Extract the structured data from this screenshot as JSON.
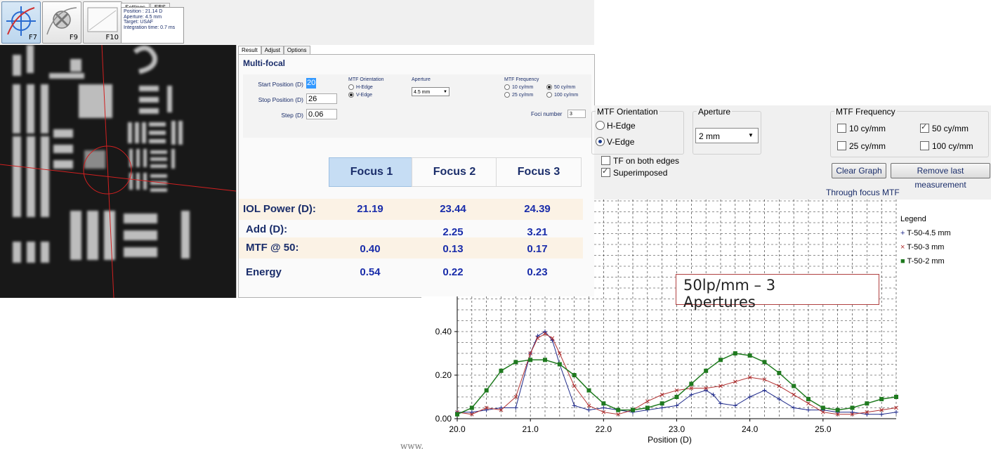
{
  "toolbar": {
    "buttons": [
      {
        "key": "F7",
        "icon": "crosshair-focus-icon",
        "active": true
      },
      {
        "key": "F9",
        "icon": "cancel-target-icon",
        "active": false
      },
      {
        "key": "F10",
        "icon": "blank-frame-icon",
        "active": false
      }
    ],
    "tabs": [
      "Settings",
      "EBS"
    ],
    "info": {
      "position": "Position : 21.14 D",
      "aperture": "Aperture: 4.5 mm",
      "target": "Target: USAF",
      "integration": "Integration time: 0.7 ms"
    }
  },
  "result_panel": {
    "tabs": [
      "Result",
      "Adjust",
      "Options"
    ],
    "title": "Multi-focal",
    "start_label": "Start Position (D)",
    "start_value": "20",
    "stop_label": "Stop Position (D)",
    "stop_value": "26",
    "step_label": "Step (D)",
    "step_value": "0.06",
    "mtf_orientation_label": "MTF Orientation",
    "h_edge": "H-Edge",
    "v_edge": "V-Edge",
    "aperture_label": "Aperture",
    "aperture_value": "4.5 mm",
    "mtf_freq_label": "MTF Frequency",
    "freq_10": "10 cy/mm",
    "freq_50": "50 cy/mm",
    "freq_25": "25 cy/mm",
    "freq_100": "100 cy/mm",
    "foci_label": "Foci number",
    "foci_value": "3",
    "focus_tabs": [
      "Focus 1",
      "Focus 2",
      "Focus 3"
    ],
    "rows": [
      {
        "label": "IOL Power (D):",
        "values": [
          "21.19",
          "23.44",
          "24.39"
        ]
      },
      {
        "label": "Add (D):",
        "values": [
          "",
          "2.25",
          "3.21"
        ]
      },
      {
        "label": "MTF @ 50:",
        "values": [
          "0.40",
          "0.13",
          "0.17"
        ]
      },
      {
        "label": "Energy",
        "values": [
          "0.54",
          "0.22",
          "0.23"
        ]
      }
    ]
  },
  "mtf_settings": {
    "orientation_label": "MTF Orientation",
    "h_edge": "H-Edge",
    "v_edge": "V-Edge",
    "v_edge_selected": true,
    "tf_both": "TF on both edges",
    "superimposed": "Superimposed",
    "aperture_label": "Aperture",
    "aperture_value": "2 mm",
    "freq_label": "MTF Frequency",
    "freq_10": "10 cy/mm",
    "freq_50": "50 cy/mm",
    "freq_25": "25 cy/mm",
    "freq_100": "100 cy/mm",
    "clear_graph": "Clear Graph",
    "remove_last": "Remove last measurement"
  },
  "chart_data": {
    "type": "line",
    "title": "Through focus MTF",
    "xlabel": "Position (D)",
    "ylabel": "",
    "xlim": [
      20.0,
      26.0
    ],
    "ylim": [
      0.0,
      0.6
    ],
    "xticks": [
      "20.0",
      "21.0",
      "22.0",
      "23.0",
      "24.0",
      "25.0"
    ],
    "yticks": [
      "0.00",
      "0.20",
      "0.40"
    ],
    "grid": true,
    "legend_title": "Legend",
    "legend_placement": "right",
    "series": [
      {
        "name": "T-50-4.5 mm",
        "marker": "+",
        "color": "#1f2a8a",
        "x": [
          20.0,
          20.2,
          20.4,
          20.6,
          20.8,
          21.0,
          21.1,
          21.2,
          21.3,
          21.4,
          21.6,
          21.8,
          22.0,
          22.2,
          22.4,
          22.6,
          22.8,
          23.0,
          23.2,
          23.4,
          23.5,
          23.6,
          23.8,
          24.0,
          24.2,
          24.4,
          24.6,
          24.8,
          25.0,
          25.2,
          25.4,
          25.6,
          25.8,
          26.0
        ],
        "y": [
          0.03,
          0.03,
          0.04,
          0.05,
          0.05,
          0.3,
          0.38,
          0.4,
          0.36,
          0.25,
          0.06,
          0.04,
          0.05,
          0.04,
          0.03,
          0.04,
          0.05,
          0.06,
          0.11,
          0.13,
          0.11,
          0.07,
          0.06,
          0.1,
          0.13,
          0.09,
          0.05,
          0.04,
          0.04,
          0.03,
          0.03,
          0.02,
          0.02,
          0.03
        ]
      },
      {
        "name": "T-50-3 mm",
        "marker": "x",
        "color": "#b03030",
        "x": [
          20.0,
          20.2,
          20.4,
          20.6,
          20.8,
          21.0,
          21.1,
          21.2,
          21.3,
          21.4,
          21.6,
          21.8,
          22.0,
          22.2,
          22.4,
          22.6,
          22.8,
          23.0,
          23.2,
          23.4,
          23.6,
          23.8,
          24.0,
          24.2,
          24.4,
          24.6,
          24.8,
          25.0,
          25.2,
          25.4,
          25.6,
          25.8,
          26.0
        ],
        "y": [
          0.03,
          0.02,
          0.05,
          0.04,
          0.1,
          0.3,
          0.37,
          0.39,
          0.37,
          0.3,
          0.15,
          0.06,
          0.03,
          0.02,
          0.04,
          0.08,
          0.11,
          0.13,
          0.14,
          0.14,
          0.15,
          0.17,
          0.19,
          0.18,
          0.15,
          0.11,
          0.07,
          0.03,
          0.02,
          0.02,
          0.03,
          0.04,
          0.05
        ]
      },
      {
        "name": "T-50-2 mm",
        "marker": "square",
        "color": "#1f7a1f",
        "x": [
          20.0,
          20.2,
          20.4,
          20.6,
          20.8,
          21.0,
          21.2,
          21.4,
          21.6,
          21.8,
          22.0,
          22.2,
          22.4,
          22.6,
          22.8,
          23.0,
          23.2,
          23.4,
          23.6,
          23.8,
          24.0,
          24.2,
          24.4,
          24.6,
          24.8,
          25.0,
          25.2,
          25.4,
          25.6,
          25.8,
          26.0
        ],
        "y": [
          0.02,
          0.05,
          0.13,
          0.22,
          0.26,
          0.27,
          0.27,
          0.25,
          0.2,
          0.13,
          0.07,
          0.04,
          0.04,
          0.05,
          0.07,
          0.1,
          0.16,
          0.22,
          0.27,
          0.3,
          0.29,
          0.26,
          0.21,
          0.15,
          0.09,
          0.05,
          0.04,
          0.05,
          0.07,
          0.09,
          0.1
        ]
      }
    ]
  },
  "callout": {
    "line1": "50lp/mm – 3",
    "line2": "Apertures"
  },
  "watermark": "www."
}
